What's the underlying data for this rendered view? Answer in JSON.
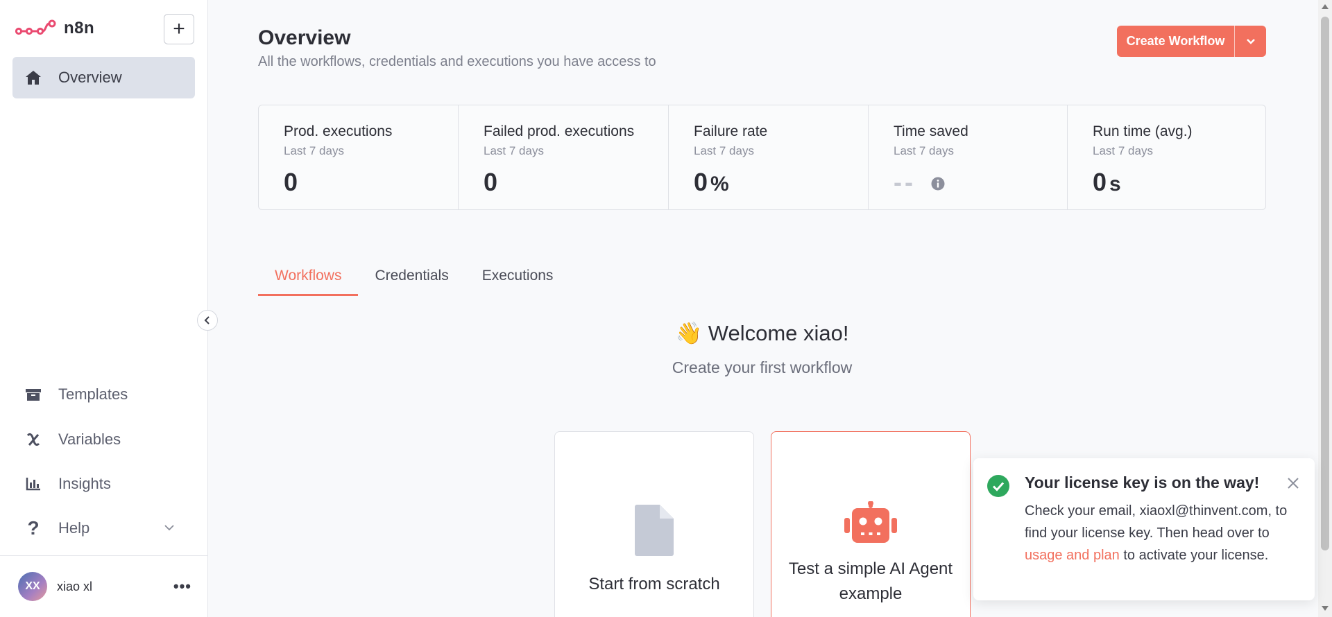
{
  "brand": {
    "name": "n8n",
    "accent": "#ea4b71"
  },
  "sidebar": {
    "new_button": "+",
    "overview": {
      "label": "Overview",
      "icon": "home-icon"
    },
    "items": [
      {
        "label": "Templates",
        "icon": "box-icon"
      },
      {
        "label": "Variables",
        "icon": "variable-icon"
      },
      {
        "label": "Insights",
        "icon": "chart-icon"
      },
      {
        "label": "Help",
        "icon": "question-icon"
      }
    ],
    "user": {
      "initials": "XX",
      "name": "xiao xl",
      "menu": "•••"
    }
  },
  "header": {
    "title": "Overview",
    "subtitle": "All the workflows, credentials and executions you have access to",
    "create_button": "Create Workflow"
  },
  "stats": [
    {
      "title": "Prod. executions",
      "period": "Last 7 days",
      "value": "0",
      "unit": ""
    },
    {
      "title": "Failed prod. executions",
      "period": "Last 7 days",
      "value": "0",
      "unit": ""
    },
    {
      "title": "Failure rate",
      "period": "Last 7 days",
      "value": "0",
      "unit": "%"
    },
    {
      "title": "Time saved",
      "period": "Last 7 days",
      "value": "--",
      "unit": ""
    },
    {
      "title": "Run time (avg.)",
      "period": "Last 7 days",
      "value": "0",
      "unit": "s"
    }
  ],
  "tabs": [
    {
      "label": "Workflows",
      "active": true
    },
    {
      "label": "Credentials",
      "active": false
    },
    {
      "label": "Executions",
      "active": false
    }
  ],
  "welcome": {
    "emoji": "👋",
    "title": "Welcome xiao!",
    "subtitle": "Create your first workflow"
  },
  "cards": [
    {
      "label": "Start from scratch",
      "icon": "file-icon"
    },
    {
      "label": "Test a simple AI Agent example",
      "icon": "robot-icon"
    }
  ],
  "toast": {
    "title": "Your license key is on the way!",
    "body_prefix": "Check your email, xiaoxl@thinvent.com, to find your license key. Then head over to ",
    "link": "usage and plan",
    "body_suffix": " to activate your license."
  },
  "colors": {
    "accent": "#f2705e",
    "success": "#2ea85d",
    "active_nav_bg": "#dde1ea"
  }
}
